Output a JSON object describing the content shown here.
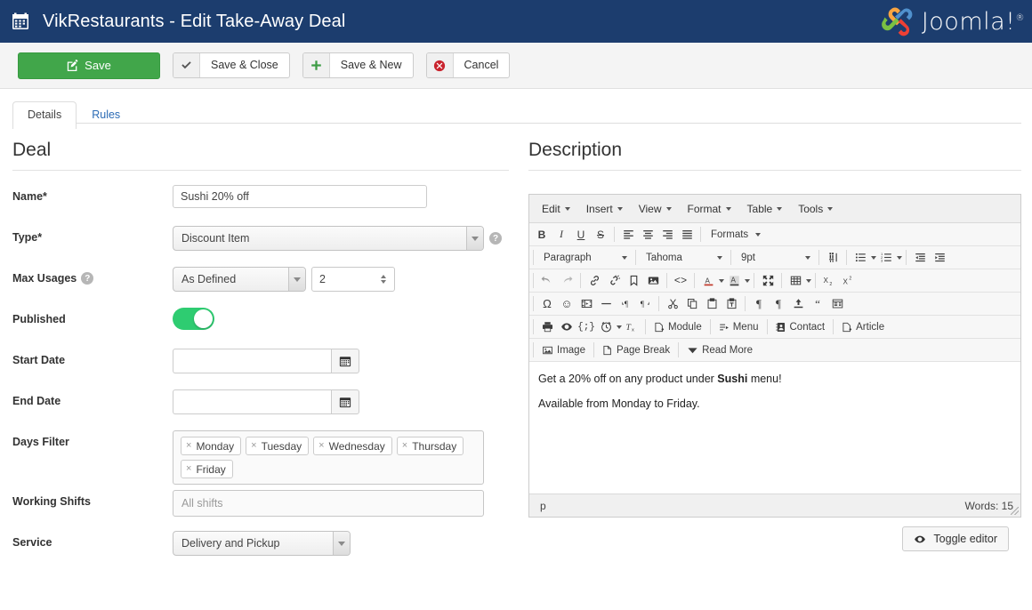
{
  "header": {
    "icon": "calendar-icon",
    "title": "VikRestaurants - Edit Take-Away Deal",
    "brand": "Joomla!",
    "brand_sup": "®",
    "bar_color": "#1c3d6e"
  },
  "toolbar": {
    "save_label": "Save",
    "save_color": "#41a64a",
    "save_close_label": "Save & Close",
    "save_new_label": "Save & New",
    "cancel_label": "Cancel"
  },
  "tabs": [
    {
      "label": "Details",
      "active": true
    },
    {
      "label": "Rules",
      "active": false
    }
  ],
  "deal": {
    "section_title": "Deal",
    "name": {
      "label": "Name*",
      "value": "Sushi 20% off"
    },
    "type": {
      "label": "Type*",
      "value": "Discount Item",
      "help": "?"
    },
    "max_usages": {
      "label": "Max Usages",
      "help": "?",
      "mode": "As Defined",
      "amount": "2"
    },
    "published": {
      "label": "Published",
      "state": "on",
      "color": "#2ecc71"
    },
    "start_date": {
      "label": "Start Date",
      "value": "",
      "button": "calendar-icon"
    },
    "end_date": {
      "label": "End Date",
      "value": "",
      "button": "calendar-icon"
    },
    "days_filter": {
      "label": "Days Filter",
      "tags": [
        "Monday",
        "Tuesday",
        "Wednesday",
        "Thursday",
        "Friday"
      ],
      "remove_glyph": "×"
    },
    "working_shifts": {
      "label": "Working Shifts",
      "placeholder": "All shifts",
      "value": ""
    },
    "service": {
      "label": "Service",
      "value": "Delivery and Pickup"
    }
  },
  "description": {
    "section_title": "Description",
    "menubar": [
      "Edit",
      "Insert",
      "View",
      "Format",
      "Table",
      "Tools"
    ],
    "row1": {
      "bold": "B",
      "italic": "I",
      "underline": "U",
      "strike": "S",
      "formats_label": "Formats"
    },
    "row2": {
      "block": "Paragraph",
      "font": "Tahoma",
      "size": "9pt"
    },
    "row4_labels": {
      "module": "Module",
      "menu": "Menu",
      "contact": "Contact",
      "article": "Article"
    },
    "row5_labels": {
      "image": "Image",
      "page_break": "Page Break",
      "read_more": "Read More"
    },
    "content": {
      "p1_before": "Get a 20% off on any product under ",
      "p1_bold": "Sushi",
      "p1_after": " menu!",
      "p2": "Available from Monday to Friday."
    },
    "status": {
      "path": "p",
      "words": "Words: 15"
    },
    "toggle_editor_label": "Toggle editor"
  }
}
